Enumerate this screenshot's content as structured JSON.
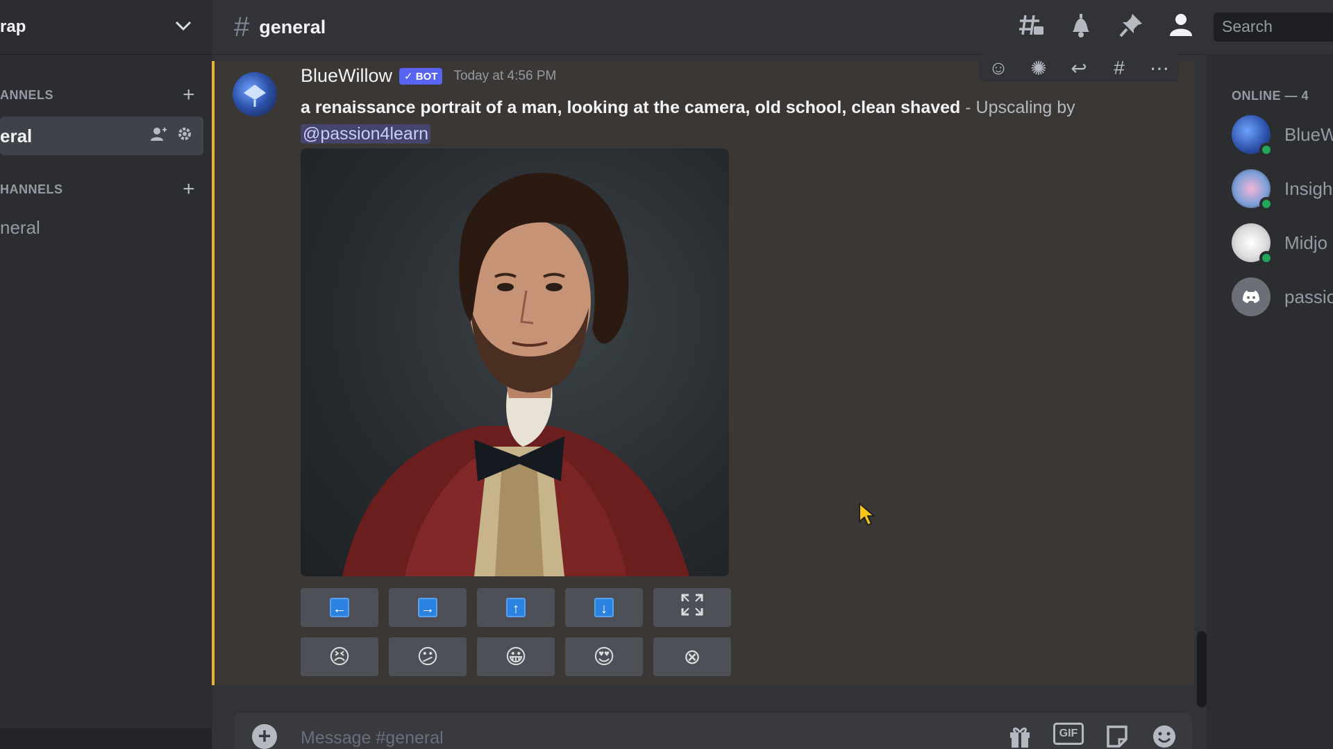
{
  "sidebar": {
    "server_name": "rap",
    "categories": [
      {
        "label": "ANNELS",
        "channel": "eral",
        "active": true
      },
      {
        "label": "HANNELS",
        "channel": "neral",
        "active": false
      }
    ]
  },
  "topbar": {
    "channel_name": "general",
    "search_placeholder": "Search"
  },
  "message": {
    "username": "BlueWillow",
    "badge": "✓ BOT",
    "timestamp": "Today at 4:56 PM",
    "prompt": "a renaissance portrait of a man, looking at the camera, old school, clean shaved",
    "suffix": " - Upscaling by",
    "mention": "@passion4learn",
    "buttons_row1": [
      "⬅",
      "➡",
      "⬆",
      "⬇",
      "expand"
    ],
    "buttons_row2": [
      "😣",
      "😕",
      "😀",
      "😍",
      "⊗"
    ]
  },
  "composer": {
    "placeholder": "Message #general",
    "gif_label": "GIF"
  },
  "members": {
    "heading": "ONLINE — 4",
    "list": [
      {
        "name": "BlueW"
      },
      {
        "name": "Insigh"
      },
      {
        "name": "Midjo"
      },
      {
        "name": "passio"
      }
    ]
  },
  "colors": {
    "accent": "#5865f2",
    "highlight_bar": "#f0b232",
    "online": "#23a55a"
  }
}
